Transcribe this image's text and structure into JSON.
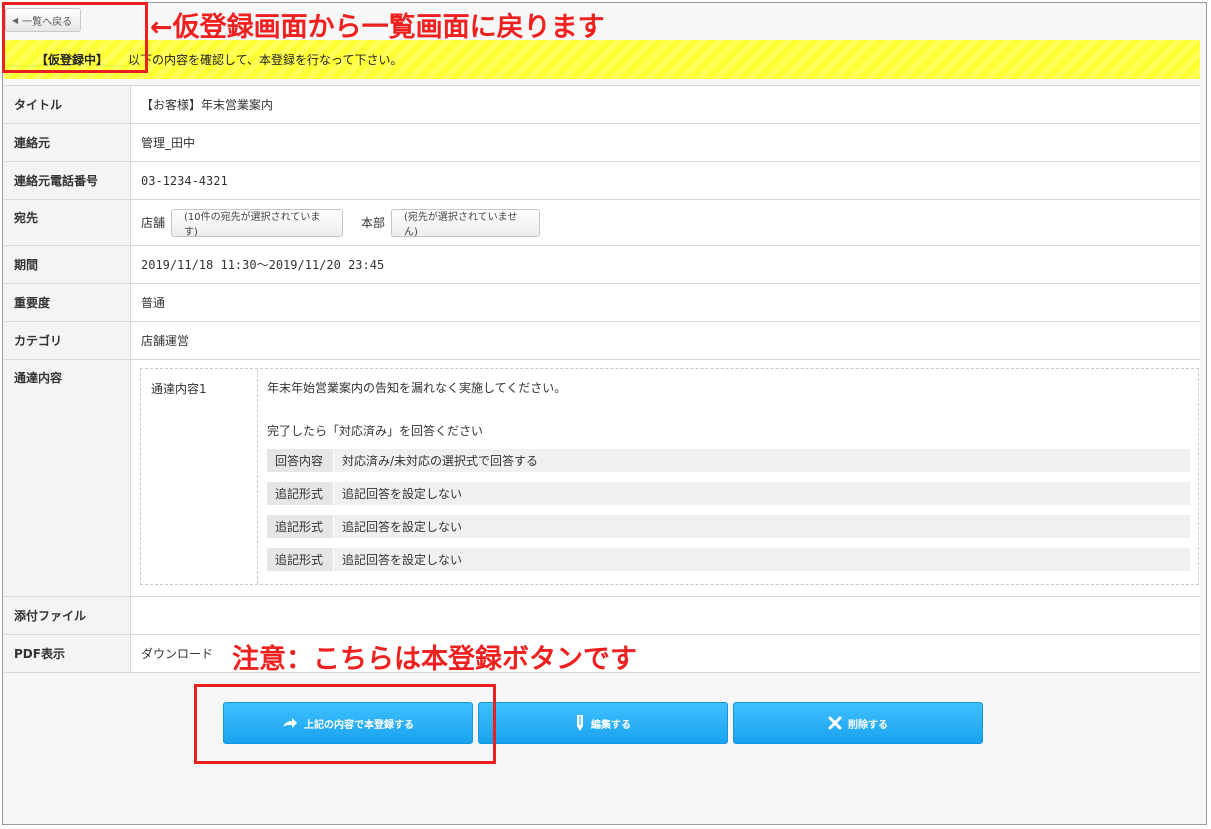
{
  "back_button": {
    "label": "一覧へ戻る"
  },
  "banner": {
    "status": "【仮登録中】",
    "message": "以下の内容を確認して、本登録を行なって下さい。"
  },
  "fields": {
    "title": {
      "label": "タイトル",
      "value": "【お客様】年末営業案内"
    },
    "contact": {
      "label": "連絡元",
      "value": "管理_田中"
    },
    "phone": {
      "label": "連絡元電話番号",
      "value": "03-1234-4321"
    },
    "destination": {
      "label": "宛先",
      "store_label": "店舗",
      "store_button": "(10件の宛先が選択されています)",
      "hq_label": "本部",
      "hq_button": "(宛先が選択されていません)"
    },
    "period": {
      "label": "期間",
      "value": "2019/11/18 11:30〜2019/11/20 23:45"
    },
    "importance": {
      "label": "重要度",
      "value": "普通"
    },
    "category": {
      "label": "カテゴリ",
      "value": "店舗運営"
    },
    "notice": {
      "label": "通達内容",
      "item_label": "通達内容1",
      "text1": "年末年始営業案内の告知を漏れなく実施してください。",
      "text2": "完了したら「対応済み」を回答ください",
      "answers": [
        {
          "key": "回答内容",
          "value": "対応済み/未対応の選択式で回答する"
        },
        {
          "key": "追記形式",
          "value": "追記回答を設定しない"
        },
        {
          "key": "追記形式",
          "value": "追記回答を設定しない"
        },
        {
          "key": "追記形式",
          "value": "追記回答を設定しない"
        }
      ]
    },
    "attachment": {
      "label": "添付ファイル",
      "value": ""
    },
    "pdf": {
      "label": "PDF表示",
      "value": "ダウンロード"
    }
  },
  "actions": {
    "register": "上記の内容で本登録する",
    "edit": "編集する",
    "delete": "削除する"
  },
  "annotations": {
    "back_note": "←仮登録画面から一覧画面に戻ります",
    "register_note": "注意：こちらは本登録ボタンです"
  },
  "colors": {
    "banner": "#ffff33",
    "button": "#1aa2f0",
    "annotation": "#ef2020"
  },
  "icons": {
    "back": "triangle-left-icon",
    "register": "arrow-forward-icon",
    "edit": "pencil-icon",
    "delete": "x-icon"
  }
}
